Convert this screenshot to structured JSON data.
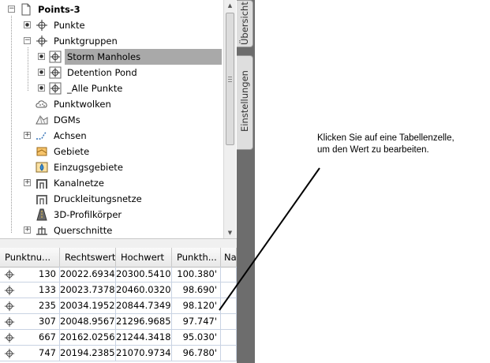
{
  "tree": {
    "root": "Points-3",
    "items": [
      {
        "label": "Punkte",
        "icon": "point-icon"
      },
      {
        "label": "Punktgruppen",
        "icon": "point-group-icon"
      },
      {
        "label": "Storm Manholes",
        "icon": "point-group-icon",
        "selected": true
      },
      {
        "label": "Detention Pond",
        "icon": "point-group-icon"
      },
      {
        "label": "_Alle Punkte",
        "icon": "point-group-icon"
      },
      {
        "label": "Punktwolken",
        "icon": "point-cloud-icon"
      },
      {
        "label": "DGMs",
        "icon": "surface-icon"
      },
      {
        "label": "Achsen",
        "icon": "alignment-icon"
      },
      {
        "label": "Gebiete",
        "icon": "site-icon"
      },
      {
        "label": "Einzugsgebiete",
        "icon": "catchment-icon"
      },
      {
        "label": "Kanalnetze",
        "icon": "pipe-network-icon"
      },
      {
        "label": "Druckleitungsnetze",
        "icon": "pressure-network-icon"
      },
      {
        "label": "3D-Profilkörper",
        "icon": "corridor-icon"
      },
      {
        "label": "Querschnitte",
        "icon": "sections-icon"
      }
    ]
  },
  "table": {
    "headers": [
      "Punktnu...",
      "Rechtswert",
      "Hochwert",
      "Punkth...",
      "Na"
    ],
    "rows": [
      [
        "130",
        "20022.6934'",
        "20300.5410'",
        "100.380'"
      ],
      [
        "133",
        "20023.7378'",
        "20460.0320'",
        "98.690'"
      ],
      [
        "235",
        "20034.1952'",
        "20844.7349'",
        "98.120'"
      ],
      [
        "307",
        "20048.9567'",
        "21296.9685'",
        "97.747'"
      ],
      [
        "667",
        "20162.0256'",
        "21244.3418'",
        "95.030'"
      ],
      [
        "747",
        "20194.2385'",
        "21070.9734'",
        "96.780'"
      ]
    ]
  },
  "sidebar": {
    "tab_top": "Übersicht",
    "tab_bottom": "Einstellungen"
  },
  "annotation": {
    "line1": "Klicken Sie auf eine Tabellenzelle,",
    "line2": "um den Wert zu bearbeiten."
  },
  "colors": {
    "selection": "#a9a9a9",
    "sidebar": "#6d6d6d",
    "grid": "#c9d3e3"
  }
}
